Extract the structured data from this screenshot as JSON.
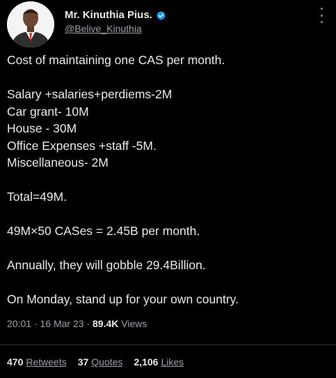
{
  "author": {
    "display_name": "Mr. Kinuthia Pius.",
    "handle": "@Belive_Kinuthia",
    "verified_icon": "verified-badge-icon",
    "accent_color": "#1d9bf0"
  },
  "tweet": {
    "lines": [
      "Cost of maintaining one CAS per month.",
      "",
      "Salary +salaries+perdiems-2M",
      "Car grant- 10M",
      "House - 30M",
      "Office Expenses +staff -5M.",
      "Miscellaneous- 2M",
      "",
      "Total=49M.",
      "",
      "49M×50 CASes = 2.45B per month.",
      "",
      "Annually, they will gobble 29.4Billion.",
      "",
      "On Monday, stand up for your own country."
    ]
  },
  "meta": {
    "time": "20:01",
    "separator": "·",
    "date": "16 Mar 23",
    "views_count": "89.4K",
    "views_label": "Views"
  },
  "stats": {
    "retweets_count": "470",
    "retweets_label": "Retweets",
    "quotes_count": "37",
    "quotes_label": "Quotes",
    "likes_count": "2,106",
    "likes_label": "Likes"
  }
}
